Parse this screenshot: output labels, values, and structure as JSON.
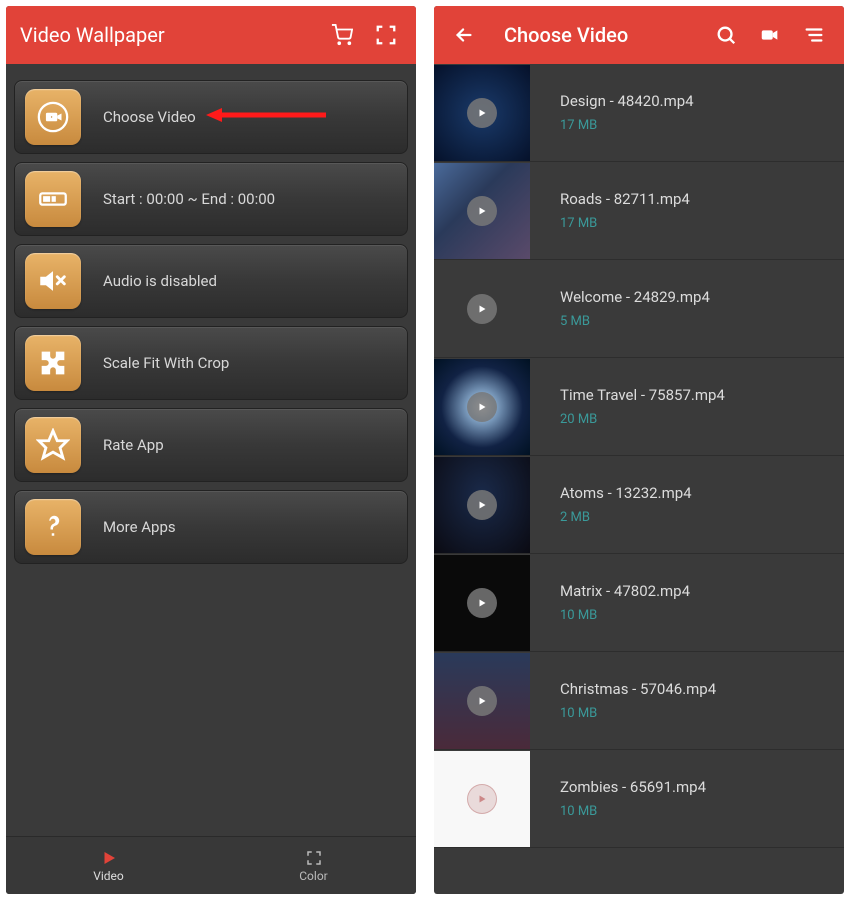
{
  "left": {
    "title": "Video Wallpaper",
    "menu": [
      {
        "label": "Choose Video",
        "icon": "camera-icon"
      },
      {
        "label": "Start : 00:00 ~ End : 00:00",
        "icon": "timeline-icon"
      },
      {
        "label": "Audio is disabled",
        "icon": "mute-icon"
      },
      {
        "label": "Scale Fit With Crop",
        "icon": "puzzle-icon"
      },
      {
        "label": "Rate App",
        "icon": "star-icon"
      },
      {
        "label": "More Apps",
        "icon": "question-icon"
      }
    ],
    "tabs": {
      "video": "Video",
      "color": "Color"
    }
  },
  "right": {
    "title": "Choose Video",
    "videos": [
      {
        "name": "Design - 48420.mp4",
        "size": "17 MB",
        "thumb": "blue1"
      },
      {
        "name": "Roads - 82711.mp4",
        "size": "17 MB",
        "thumb": "city"
      },
      {
        "name": "Welcome - 24829.mp4",
        "size": "5 MB",
        "thumb": "gray"
      },
      {
        "name": "Time Travel - 75857.mp4",
        "size": "20 MB",
        "thumb": "burst"
      },
      {
        "name": "Atoms - 13232.mp4",
        "size": "2 MB",
        "thumb": "dark1"
      },
      {
        "name": "Matrix - 47802.mp4",
        "size": "10 MB",
        "thumb": "black"
      },
      {
        "name": "Christmas - 57046.mp4",
        "size": "10 MB",
        "thumb": "xmas"
      },
      {
        "name": "Zombies - 65691.mp4",
        "size": "10 MB",
        "thumb": "white"
      }
    ]
  }
}
